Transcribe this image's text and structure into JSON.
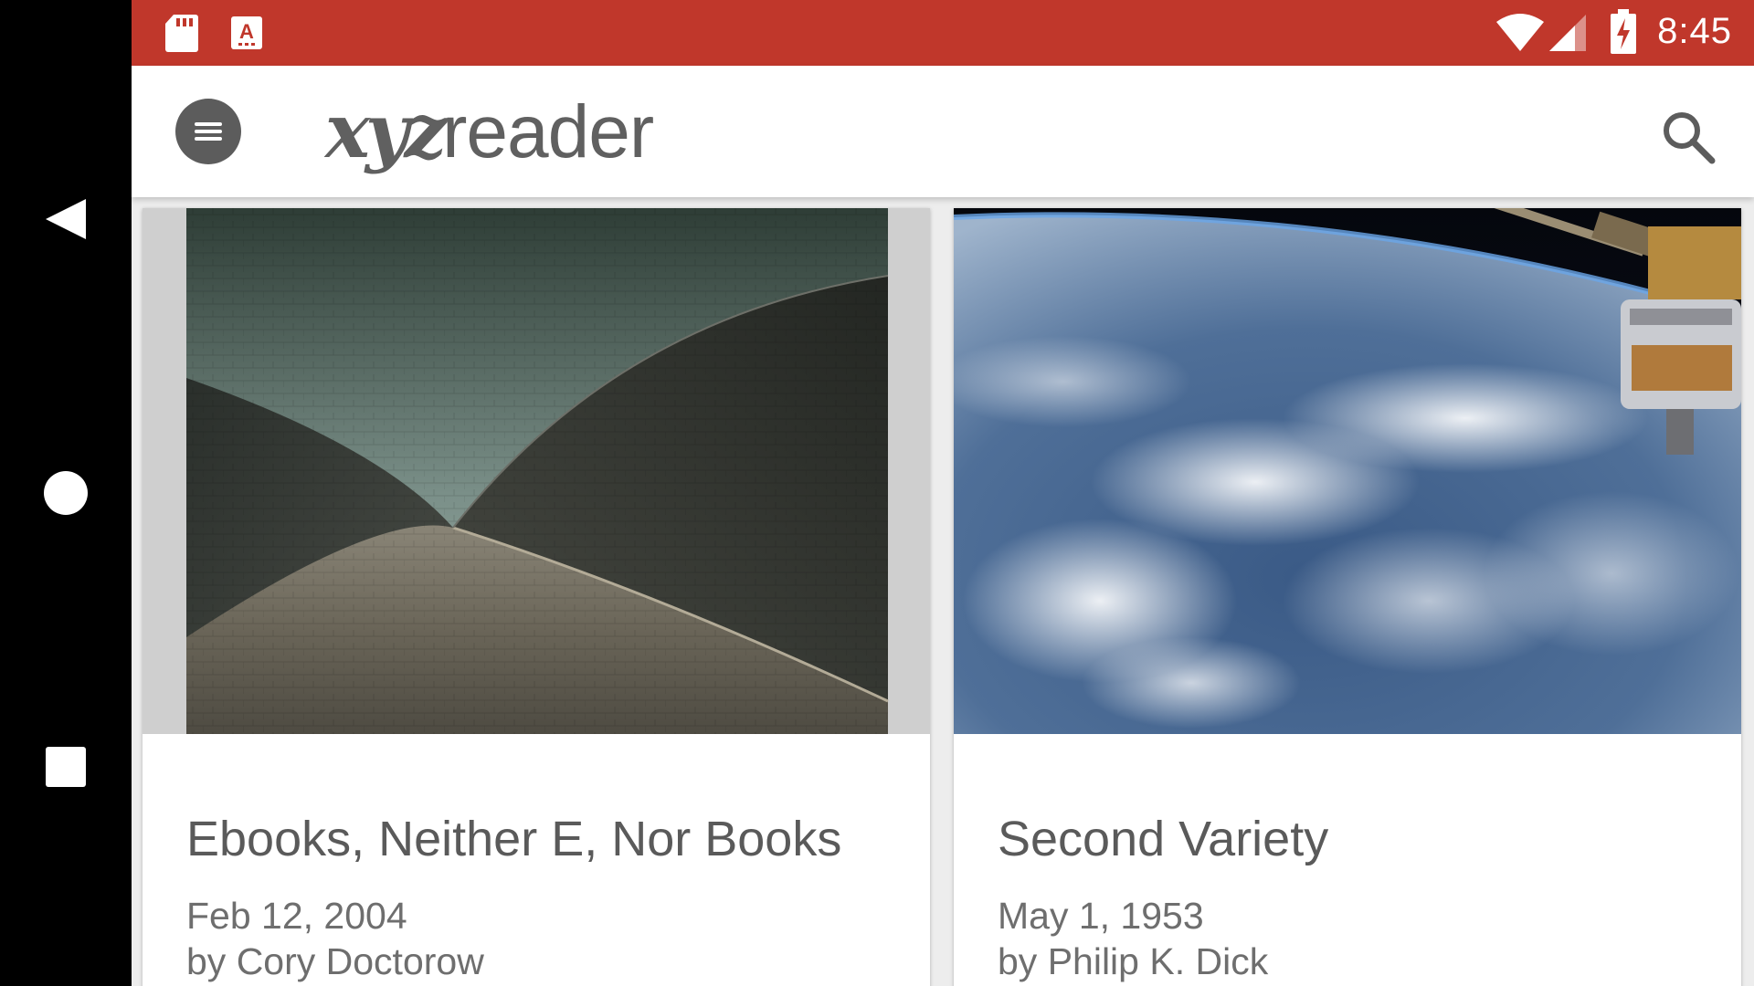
{
  "status_bar": {
    "time": "8:45",
    "icons": [
      "sd-card-icon",
      "keyboard-a-icon",
      "wifi-icon",
      "cell-signal-icon",
      "battery-charging-icon"
    ]
  },
  "nav_bar": {
    "icons": [
      "back-icon",
      "home-icon",
      "recents-icon"
    ]
  },
  "app_bar": {
    "logo_xyz": "xyz",
    "logo_reader": "reader",
    "menu_icon": "menu-icon",
    "search_icon": "search-icon"
  },
  "articles": [
    {
      "title": "Ebooks, Neither E, Nor Books",
      "date": "Feb 12, 2004",
      "author": "by Cory Doctorow",
      "image": "opera-house-shells-photo"
    },
    {
      "title": "Second Variety",
      "date": "May 1, 1953",
      "author": "by Philip K. Dick",
      "image": "earth-from-space-station-photo"
    }
  ],
  "colors": {
    "status_bar": "#c0372b",
    "app_bar": "#ffffff",
    "text_primary": "#5a5a5a"
  }
}
